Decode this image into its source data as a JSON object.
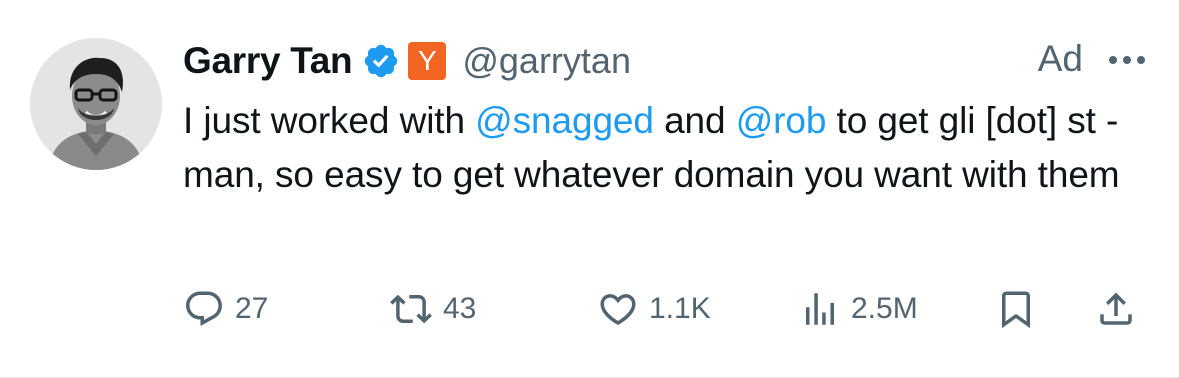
{
  "tweet": {
    "author_name": "Garry Tan",
    "affiliation_badge": "Y",
    "handle": "@garrytan",
    "ad_label": "Ad",
    "text_parts": {
      "p1": "I just worked with ",
      "mention1": "@snagged",
      "p2": " and ",
      "mention2": "@rob",
      "p3": " to get gli [dot] st - man, so easy to get whatever domain you want with them"
    },
    "icons": {
      "verified": "verified-badge-icon",
      "more": "more-dots-icon",
      "reply": "reply-icon",
      "retweet": "retweet-icon",
      "like": "heart-icon",
      "views": "views-icon",
      "bookmark": "bookmark-icon",
      "share": "share-icon"
    },
    "stats": {
      "replies": "27",
      "retweets": "43",
      "likes": "1.1K",
      "views": "2.5M"
    }
  },
  "colors": {
    "accent": "#1d9bf0",
    "secondary_text": "#536471",
    "primary_text": "#0f1419",
    "affiliation_bg": "#f26522"
  }
}
